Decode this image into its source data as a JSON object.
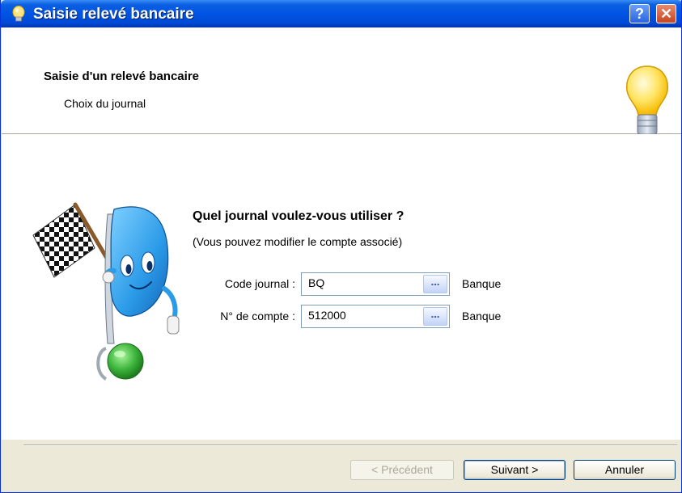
{
  "window": {
    "title": "Saisie relevé bancaire",
    "help_label": "?",
    "close_label": "✕"
  },
  "header": {
    "title": "Saisie d'un relevé bancaire",
    "subtitle": "Choix du journal"
  },
  "form": {
    "question": "Quel journal voulez-vous utiliser ?",
    "hint": "(Vous pouvez modifier le compte associé)",
    "code_journal": {
      "label": "Code journal :",
      "value": "BQ",
      "browse_label": "...",
      "description": "Banque"
    },
    "compte": {
      "label": "N° de compte :",
      "value": "512000",
      "browse_label": "...",
      "description": "Banque"
    }
  },
  "buttons": {
    "previous": "< Précédent",
    "next": "Suivant >",
    "cancel": "Annuler"
  },
  "colors": {
    "titlebar": "#0054e3",
    "dialog_bg": "#ece9d8",
    "mascot_blue": "#2b9be8",
    "light_green": "#3cb43c"
  }
}
